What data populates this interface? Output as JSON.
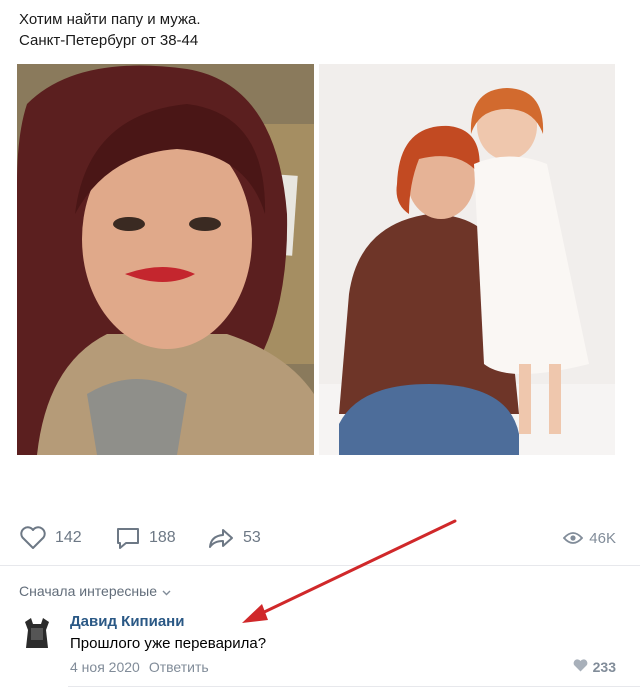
{
  "post": {
    "text_line1": "Хотим найти папу и мужа.",
    "text_line2": "Санкт-Петербург от 38-44"
  },
  "photos": [
    {
      "name": "selfie-photo"
    },
    {
      "name": "mother-daughter-photo"
    }
  ],
  "actions": {
    "likes": "142",
    "comments": "188",
    "shares": "53",
    "views": "46K"
  },
  "comments_header": {
    "sort_label": "Сначала интересные"
  },
  "comment": {
    "author": "Давид Кипиани",
    "text": "Прошлого уже переварила?",
    "date": "4 ноя 2020",
    "reply_label": "Ответить",
    "likes": "233"
  },
  "colors": {
    "link": "#2a5885",
    "muted": "#818c99",
    "icon": "#6d7885",
    "arrow": "#d0282a"
  }
}
